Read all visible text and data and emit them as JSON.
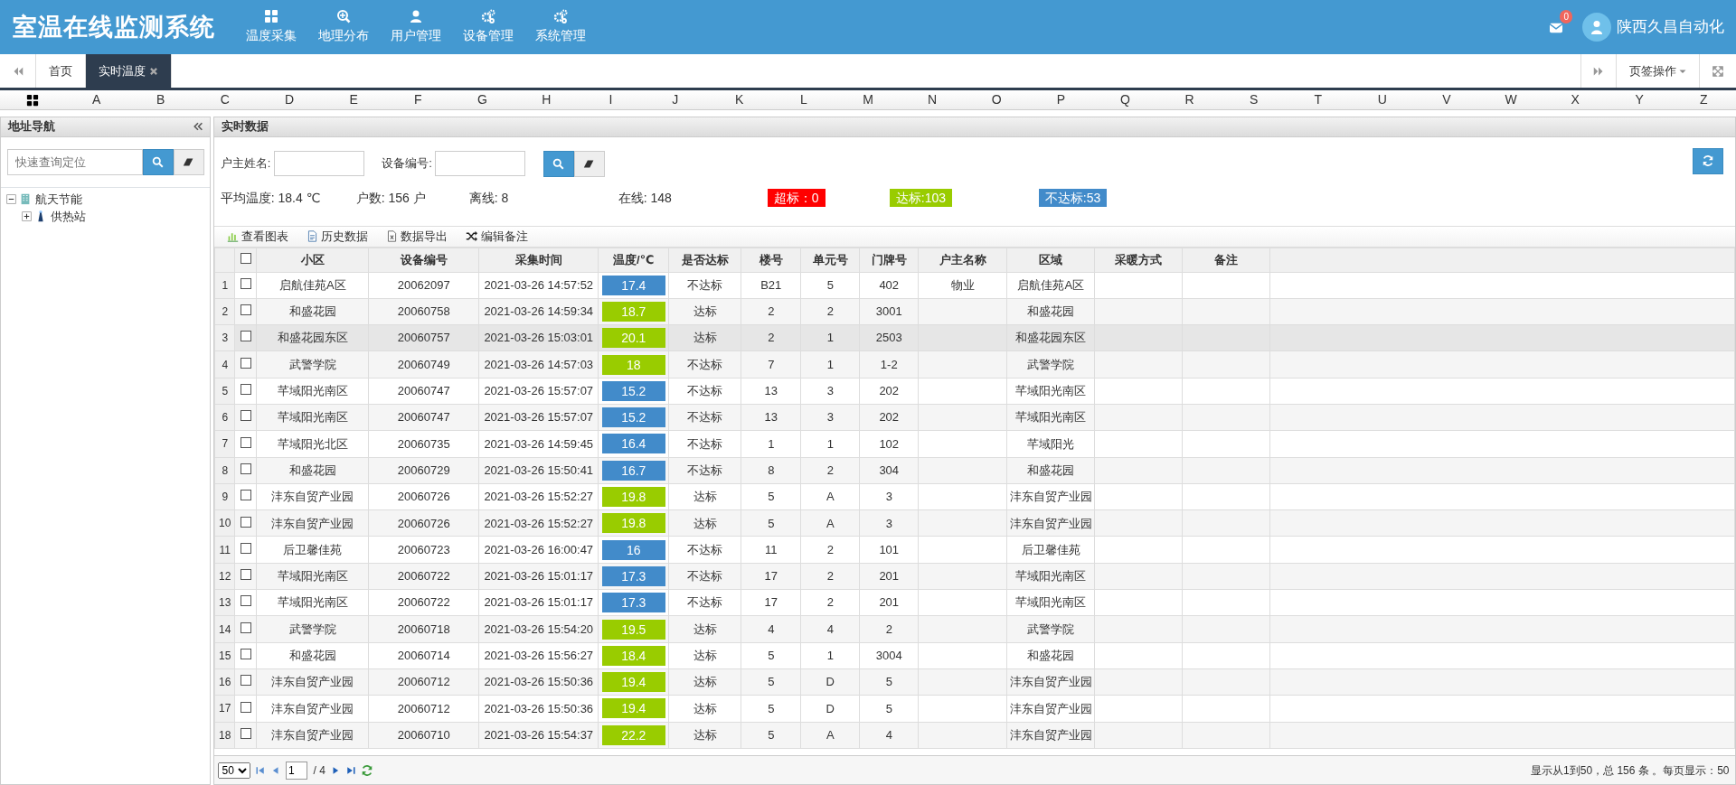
{
  "header": {
    "title": "室温在线监测系统",
    "menu": [
      {
        "label": "温度采集"
      },
      {
        "label": "地理分布"
      },
      {
        "label": "用户管理"
      },
      {
        "label": "设备管理"
      },
      {
        "label": "系统管理"
      }
    ],
    "mail_count": "0",
    "user": "陕西久昌自动化"
  },
  "tabs": [
    {
      "label": "首页",
      "selected": false,
      "closable": false
    },
    {
      "label": "实时温度",
      "selected": true,
      "closable": true
    }
  ],
  "tab_actions": "页签操作",
  "letters": [
    "A",
    "B",
    "C",
    "D",
    "E",
    "F",
    "G",
    "H",
    "I",
    "J",
    "K",
    "L",
    "M",
    "N",
    "O",
    "P",
    "Q",
    "R",
    "S",
    "T",
    "U",
    "V",
    "W",
    "X",
    "Y",
    "Z"
  ],
  "sidebar": {
    "title": "地址导航",
    "search": {
      "placeholder": "快速查询定位"
    },
    "tree": [
      {
        "label": "航天节能",
        "expanded": true,
        "children": [
          {
            "label": "供热站",
            "expanded": false
          }
        ]
      }
    ]
  },
  "panel": {
    "title": "实时数据",
    "filters": [
      {
        "label": "户主姓名:"
      },
      {
        "label": "设备编号:"
      }
    ],
    "stats": [
      {
        "kind": "text",
        "text": "平均温度: 18.4 ℃"
      },
      {
        "kind": "text",
        "text": "户数: 156 户"
      },
      {
        "kind": "text",
        "text": "离线: 8"
      },
      {
        "kind": "text",
        "text": "在线: 148"
      },
      {
        "kind": "tag",
        "text": "超标：0",
        "color": "#ff0000"
      },
      {
        "kind": "tag",
        "text": "达标:103",
        "color": "#99cc00"
      },
      {
        "kind": "tag",
        "text": "不达标:53",
        "color": "#428bca"
      }
    ],
    "toolbar": [
      {
        "label": "查看图表"
      },
      {
        "label": "历史数据"
      },
      {
        "label": "数据导出"
      },
      {
        "label": "编辑备注"
      }
    ]
  },
  "table": {
    "select_all_checked": false,
    "columns": [
      "小区",
      "设备编号",
      "采集时间",
      "温度/℃",
      "是否达标",
      "楼号",
      "单元号",
      "门牌号",
      "户主名称",
      "区域",
      "采暖方式",
      "备注"
    ],
    "rows": [
      {
        "n": "1",
        "cells": [
          "启航佳苑A区",
          "20062097",
          "2021-03-26 14:57:52",
          "17.4",
          "不达标",
          "B21",
          "5",
          "402",
          "物业",
          "启航佳苑A区",
          "",
          ""
        ],
        "color": "#428bca",
        "selected": false,
        "checked": false
      },
      {
        "n": "2",
        "cells": [
          "和盛花园",
          "20060758",
          "2021-03-26 14:59:34",
          "18.7",
          "达标",
          "2",
          "2",
          "3001",
          "",
          "和盛花园",
          "",
          ""
        ],
        "color": "#99cc00",
        "selected": false,
        "checked": false
      },
      {
        "n": "3",
        "cells": [
          "和盛花园东区",
          "20060757",
          "2021-03-26 15:03:01",
          "20.1",
          "达标",
          "2",
          "1",
          "2503",
          "",
          "和盛花园东区",
          "",
          ""
        ],
        "color": "#99cc00",
        "selected": true,
        "checked": false
      },
      {
        "n": "4",
        "cells": [
          "武警学院",
          "20060749",
          "2021-03-26 14:57:03",
          "18",
          "不达标",
          "7",
          "1",
          "1-2",
          "",
          "武警学院",
          "",
          ""
        ],
        "color": "#99cc00",
        "selected": false,
        "checked": false
      },
      {
        "n": "5",
        "cells": [
          "芊域阳光南区",
          "20060747",
          "2021-03-26 15:57:07",
          "15.2",
          "不达标",
          "13",
          "3",
          "202",
          "",
          "芊域阳光南区",
          "",
          ""
        ],
        "color": "#428bca",
        "selected": false,
        "checked": false
      },
      {
        "n": "6",
        "cells": [
          "芊域阳光南区",
          "20060747",
          "2021-03-26 15:57:07",
          "15.2",
          "不达标",
          "13",
          "3",
          "202",
          "",
          "芊域阳光南区",
          "",
          ""
        ],
        "color": "#428bca",
        "selected": false,
        "checked": false
      },
      {
        "n": "7",
        "cells": [
          "芊域阳光北区",
          "20060735",
          "2021-03-26 14:59:45",
          "16.4",
          "不达标",
          "1",
          "1",
          "102",
          "",
          "芊域阳光",
          "",
          ""
        ],
        "color": "#428bca",
        "selected": false,
        "checked": false
      },
      {
        "n": "8",
        "cells": [
          "和盛花园",
          "20060729",
          "2021-03-26 15:50:41",
          "16.7",
          "不达标",
          "8",
          "2",
          "304",
          "",
          "和盛花园",
          "",
          ""
        ],
        "color": "#428bca",
        "selected": false,
        "checked": false
      },
      {
        "n": "9",
        "cells": [
          "沣东自贸产业园",
          "20060726",
          "2021-03-26 15:52:27",
          "19.8",
          "达标",
          "5",
          "A",
          "3",
          "",
          "沣东自贸产业园",
          "",
          ""
        ],
        "color": "#99cc00",
        "selected": false,
        "checked": false
      },
      {
        "n": "10",
        "cells": [
          "沣东自贸产业园",
          "20060726",
          "2021-03-26 15:52:27",
          "19.8",
          "达标",
          "5",
          "A",
          "3",
          "",
          "沣东自贸产业园",
          "",
          ""
        ],
        "color": "#99cc00",
        "selected": false,
        "checked": false
      },
      {
        "n": "11",
        "cells": [
          "后卫馨佳苑",
          "20060723",
          "2021-03-26 16:00:47",
          "16",
          "不达标",
          "11",
          "2",
          "101",
          "",
          "后卫馨佳苑",
          "",
          ""
        ],
        "color": "#428bca",
        "selected": false,
        "checked": false
      },
      {
        "n": "12",
        "cells": [
          "芊域阳光南区",
          "20060722",
          "2021-03-26 15:01:17",
          "17.3",
          "不达标",
          "17",
          "2",
          "201",
          "",
          "芊域阳光南区",
          "",
          ""
        ],
        "color": "#428bca",
        "selected": false,
        "checked": false
      },
      {
        "n": "13",
        "cells": [
          "芊域阳光南区",
          "20060722",
          "2021-03-26 15:01:17",
          "17.3",
          "不达标",
          "17",
          "2",
          "201",
          "",
          "芊域阳光南区",
          "",
          ""
        ],
        "color": "#428bca",
        "selected": false,
        "checked": false
      },
      {
        "n": "14",
        "cells": [
          "武警学院",
          "20060718",
          "2021-03-26 15:54:20",
          "19.5",
          "达标",
          "4",
          "4",
          "2",
          "",
          "武警学院",
          "",
          ""
        ],
        "color": "#99cc00",
        "selected": false,
        "checked": false
      },
      {
        "n": "15",
        "cells": [
          "和盛花园",
          "20060714",
          "2021-03-26 15:56:27",
          "18.4",
          "达标",
          "5",
          "1",
          "3004",
          "",
          "和盛花园",
          "",
          ""
        ],
        "color": "#99cc00",
        "selected": false,
        "checked": false
      },
      {
        "n": "16",
        "cells": [
          "沣东自贸产业园",
          "20060712",
          "2021-03-26 15:50:36",
          "19.4",
          "达标",
          "5",
          "D",
          "5",
          "",
          "沣东自贸产业园",
          "",
          ""
        ],
        "color": "#99cc00",
        "selected": false,
        "checked": false
      },
      {
        "n": "17",
        "cells": [
          "沣东自贸产业园",
          "20060712",
          "2021-03-26 15:50:36",
          "19.4",
          "达标",
          "5",
          "D",
          "5",
          "",
          "沣东自贸产业园",
          "",
          ""
        ],
        "color": "#99cc00",
        "selected": false,
        "checked": false
      },
      {
        "n": "18",
        "cells": [
          "沣东自贸产业园",
          "20060710",
          "2021-03-26 15:54:37",
          "22.2",
          "达标",
          "5",
          "A",
          "4",
          "",
          "沣东自贸产业园",
          "",
          ""
        ],
        "color": "#99cc00",
        "selected": false,
        "checked": false
      }
    ]
  },
  "pager": {
    "page_size": "50",
    "page": "1",
    "pages": "/ 4",
    "summary": "显示从1到50，总 156 条 。每页显示：50"
  }
}
